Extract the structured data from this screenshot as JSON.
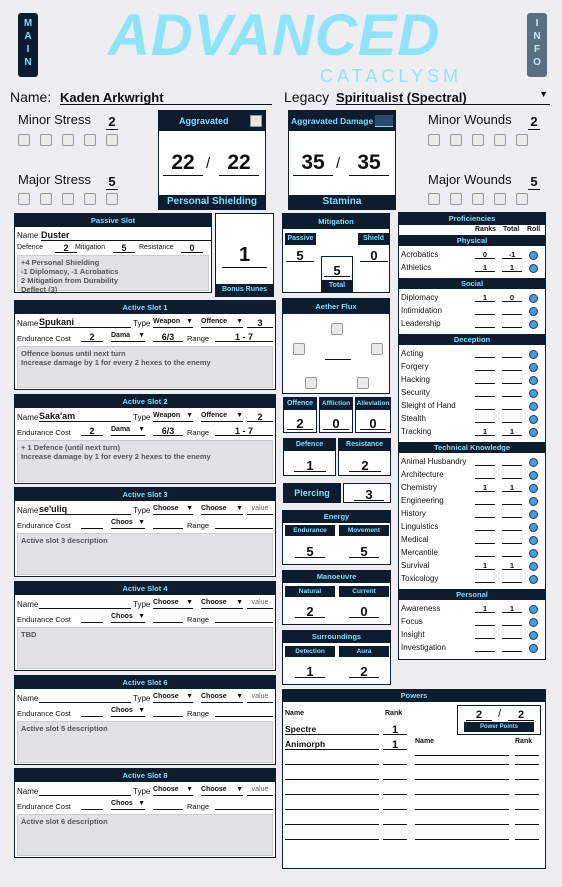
{
  "nav": {
    "main": "MAIN",
    "info": "INFO"
  },
  "logo": {
    "title": "ADVANCED",
    "subtitle": "CATACLYSM"
  },
  "header": {
    "name_label": "Name:",
    "name": "Kaden Arkwright",
    "legacy_label": "Legacy",
    "legacy": "Spiritualist (Spectral)"
  },
  "stress": {
    "minor_label": "Minor Stress",
    "minor": "2",
    "major_label": "Major Stress",
    "major": "5"
  },
  "wounds": {
    "minor_label": "Minor Wounds",
    "minor": "2",
    "major_label": "Major Wounds",
    "major": "5"
  },
  "shielding": {
    "header": "Aggravated",
    "current": "22",
    "sep": "/",
    "max": "22",
    "footer": "Personal Shielding"
  },
  "stamina": {
    "header": "Aggravated Damage",
    "current": "35",
    "sep": "/",
    "max": "35",
    "footer": "Stamina"
  },
  "passive_slot": {
    "title": "Passive Slot",
    "name_label": "Name",
    "name": "Duster",
    "defence_label": "Defence",
    "defence": "2",
    "mitigation_label": "Mitigation",
    "mitigation": "5",
    "resistance_label": "Resistance",
    "resistance": "0",
    "description": "+4 Personal Shielding\n-1 Diplomacy, -1 Acrobatics\n2 Mitigation from Durability\nDeflect (3)"
  },
  "bonus_runes": {
    "value": "1",
    "label": "Bonus Runes"
  },
  "active_slots": [
    {
      "title": "Active Slot 1",
      "name": "Spukani",
      "type": "Weapon",
      "sub": "Offence",
      "sub_val": "3",
      "cost": "2",
      "cost_type": "Dama",
      "dmg": "6/3",
      "range": "1 - 7",
      "description": "Offence bonus until next turn\nIncrease damage by 1 for every 2 hexes to the enemy"
    },
    {
      "title": "Active Slot 2",
      "name": "Saka'am",
      "type": "Weapon",
      "sub": "Offence",
      "sub_val": "2",
      "cost": "2",
      "cost_type": "Dama",
      "dmg": "6/3",
      "range": "1 - 7",
      "description": "+ 1 Defence (until next turn)\nIncrease damage by 1 for every 2 hexes to the enemy"
    },
    {
      "title": "Active Slot 3",
      "name": "se'uliq",
      "type": "Choose",
      "sub": "Choose",
      "sub_val": "value",
      "cost": "",
      "cost_type": "Choos",
      "dmg": "",
      "range": "",
      "description": "Active slot 3 description"
    },
    {
      "title": "Active Slot 4",
      "name": "",
      "type": "Choose",
      "sub": "Choose",
      "sub_val": "value",
      "cost": "",
      "cost_type": "Choos",
      "dmg": "",
      "range": "",
      "description": "TBD"
    },
    {
      "title": "Active Slot 6",
      "name": "",
      "type": "Choose",
      "sub": "Choose",
      "sub_val": "value",
      "cost": "",
      "cost_type": "Choos",
      "dmg": "",
      "range": "",
      "description": "Active slot 5 description"
    },
    {
      "title": "Active Slot 8",
      "name": "",
      "type": "Choose",
      "sub": "Choose",
      "sub_val": "value",
      "cost": "",
      "cost_type": "Choos",
      "dmg": "",
      "range": "",
      "description": "Active slot 6 description"
    }
  ],
  "slot_labels": {
    "name": "Name",
    "type": "Type",
    "cost": "Endurance Cost",
    "range": "Range"
  },
  "mitigation": {
    "title": "Mitigation",
    "passive_label": "Passive",
    "passive": "5",
    "shield_label": "Shield",
    "shield": "0",
    "total": "5",
    "total_label": "Total"
  },
  "aether_flux": {
    "title": "Aether Flux"
  },
  "combat": {
    "offence_label": "Offence",
    "offence": "2",
    "affliction_label": "Affliction",
    "affliction": "0",
    "alleviation_label": "Alleviation",
    "alleviation": "0",
    "defence_label": "Defence",
    "defence": "1",
    "resistance_label": "Resistance",
    "resistance": "2",
    "piercing_label": "Piercing",
    "piercing": "3"
  },
  "energy": {
    "title": "Energy",
    "endurance_label": "Endurance",
    "endurance": "5",
    "movement_label": "Movement",
    "movement": "5"
  },
  "manoeuvre": {
    "title": "Manoeuvre",
    "natural_label": "Natural",
    "natural": "2",
    "current_label": "Current",
    "current": "0"
  },
  "surroundings": {
    "title": "Surroundings",
    "detection_label": "Detection",
    "detection": "1",
    "aura_label": "Aura",
    "aura": "2"
  },
  "proficiencies": {
    "title": "Proficiencies",
    "col_ranks": "Ranks",
    "col_total": "Total",
    "col_roll": "Roll",
    "groups": [
      {
        "name": "Physical",
        "skills": [
          {
            "n": "Acrobatics",
            "r": "0",
            "t": "-1"
          },
          {
            "n": "Athletics",
            "r": "1",
            "t": "1"
          }
        ]
      },
      {
        "name": "Social",
        "skills": [
          {
            "n": "Diplomacy",
            "r": "1",
            "t": "0"
          },
          {
            "n": "Intimidation",
            "r": "",
            "t": ""
          },
          {
            "n": "Leadership",
            "r": "",
            "t": ""
          }
        ]
      },
      {
        "name": "Deception",
        "skills": [
          {
            "n": "Acting",
            "r": "",
            "t": ""
          },
          {
            "n": "Forgery",
            "r": "",
            "t": ""
          },
          {
            "n": "Hacking",
            "r": "",
            "t": ""
          },
          {
            "n": "Security",
            "r": "",
            "t": ""
          },
          {
            "n": "Sleight of Hand",
            "r": "",
            "t": ""
          },
          {
            "n": "Stealth",
            "r": "",
            "t": ""
          },
          {
            "n": "Tracking",
            "r": "1",
            "t": "1"
          }
        ]
      },
      {
        "name": "Technical Knowledge",
        "skills": [
          {
            "n": "Animal Husbandry",
            "r": "",
            "t": ""
          },
          {
            "n": "Architecture",
            "r": "",
            "t": ""
          },
          {
            "n": "Chemistry",
            "r": "1",
            "t": "1"
          },
          {
            "n": "Engineering",
            "r": "",
            "t": ""
          },
          {
            "n": "History",
            "r": "",
            "t": ""
          },
          {
            "n": "Linguistics",
            "r": "",
            "t": ""
          },
          {
            "n": "Medical",
            "r": "",
            "t": ""
          },
          {
            "n": "Mercantile",
            "r": "",
            "t": ""
          },
          {
            "n": "Survival",
            "r": "1",
            "t": "1"
          },
          {
            "n": "Toxicology",
            "r": "",
            "t": ""
          }
        ]
      },
      {
        "name": "Personal",
        "skills": [
          {
            "n": "Awareness",
            "r": "1",
            "t": "1"
          },
          {
            "n": "Focus",
            "r": "",
            "t": ""
          },
          {
            "n": "Insight",
            "r": "",
            "t": ""
          },
          {
            "n": "Investigation",
            "r": "",
            "t": ""
          }
        ]
      }
    ]
  },
  "powers": {
    "title": "Powers",
    "points": "2",
    "sep": "/",
    "max": "2",
    "points_label": "Power Points",
    "name_label": "Name",
    "rank_label": "Rank",
    "name_label2": "Name",
    "rank_label2": "Rank",
    "list": [
      {
        "name": "Spectre",
        "rank": "1"
      },
      {
        "name": "Animorph",
        "rank": "1"
      }
    ]
  }
}
